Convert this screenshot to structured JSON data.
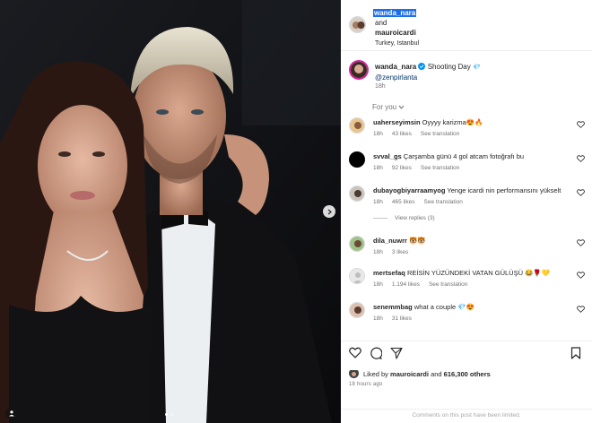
{
  "colors": {
    "accent": "#0095f6",
    "selection": "#1d6fe8",
    "muted": "#737373",
    "link": "#00376b"
  },
  "header": {
    "user1": "wanda_nara",
    "and": "and",
    "user2": "mauroicardi",
    "location": "Turkey, Istanbul",
    "more_icon": "more-horizontal-icon"
  },
  "caption": {
    "username": "wanda_nara",
    "text": "Shooting Day",
    "emoji": "💎",
    "mention": "@zenpirlanta",
    "time": "18h"
  },
  "for_you": "For you",
  "comments": [
    {
      "user": "uaherseyimsin",
      "text": "Oyyyy karizma😍🔥",
      "time": "18h",
      "likes": "43 likes",
      "action": "See translation"
    },
    {
      "user": "svval_gs",
      "text": "Çarşamba günü 4 gol atcam fotoğrafı bu",
      "time": "18h",
      "likes": "92 likes",
      "action": "See translation"
    },
    {
      "user": "dubayogbiyarraamyog",
      "text": "Yenge icardi nin performansını yükselt",
      "time": "18h",
      "likes": "465 likes",
      "action": "See translation"
    },
    {
      "user": "dila_nuwrr",
      "text": "🐯🐯",
      "time": "18h",
      "likes": "3 likes",
      "action": ""
    },
    {
      "user": "mertsefaq",
      "text": "REİSİN YÜZÜNDEKİ VATAN GÜLÜŞÜ 😂🌹💛",
      "time": "18h",
      "likes": "1.194 likes",
      "action": "See translation"
    },
    {
      "user": "senemmbag",
      "text": "what a couple 💎😍",
      "time": "18h",
      "likes": "31 likes",
      "action": ""
    }
  ],
  "view_replies": "View replies (3)",
  "likes": {
    "prefix": "Liked by",
    "user": "mauroicardi",
    "and": "and",
    "count": "616,300 others"
  },
  "posted_time": "18 hours ago",
  "comments_limited": "Comments on this post have been limited."
}
